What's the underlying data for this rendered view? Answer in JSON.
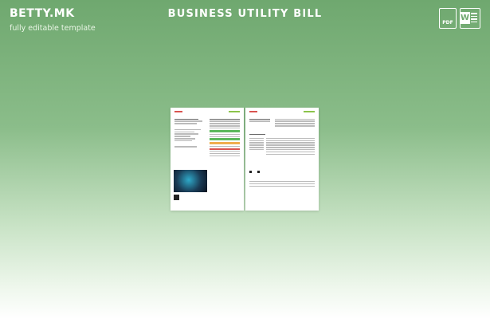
{
  "header": {
    "brand": "BETTY.MK",
    "tagline": "fully editable template",
    "title": "BUSINESS UTILITY BILL"
  },
  "downloads": {
    "pdf_label": "PDF",
    "word_label": "W"
  },
  "colors": {
    "accent_green": "#6fa86f",
    "white": "#ffffff"
  },
  "icons": [
    "pdf-file-icon",
    "word-file-icon"
  ]
}
